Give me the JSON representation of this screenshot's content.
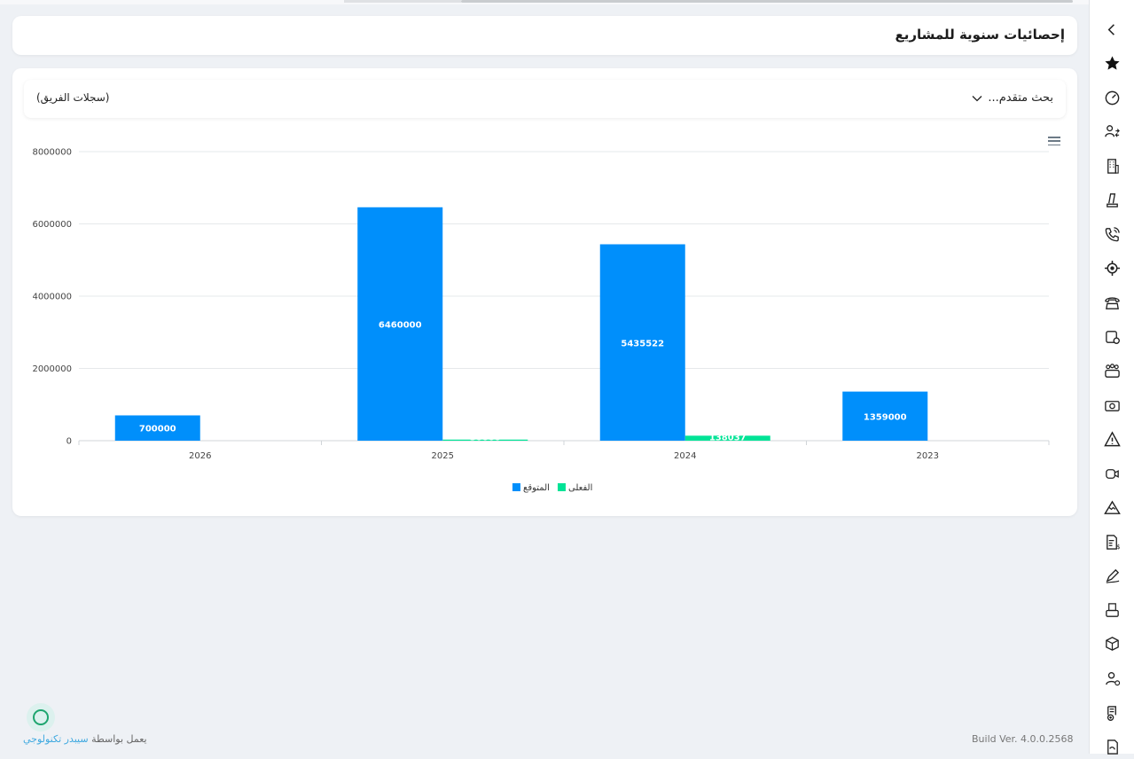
{
  "page": {
    "title": "إحصائيات سنوية للمشاريع",
    "advanced_search": "بحث متقدم...",
    "team_records": "(سجلات الفريق)",
    "footer_powered": "يعمل بواسطة",
    "footer_brand": "سيبدر تكنولوجي",
    "footer_build": "Build Ver. 4.0.0.2568"
  },
  "rail_icons": [
    "chevron-left-icon",
    "star-icon",
    "dashboard-icon",
    "users-swap-icon",
    "building-icon",
    "tool-icon",
    "phone-call-icon",
    "target-icon",
    "telephone-icon",
    "calendar-settings-icon",
    "group-icon",
    "money-icon",
    "warning-icon",
    "video-icon",
    "mountain-icon",
    "invoice-icon",
    "pen-icon",
    "printer-doc-icon",
    "box-icon",
    "user-money-icon",
    "doc-add-icon",
    "doc-hand-icon"
  ],
  "colors": {
    "expected": "#008ffb",
    "actual": "#00e396",
    "accent_brand": "#3fa9e0"
  },
  "chart_data": {
    "type": "bar",
    "categories": [
      "2026",
      "2025",
      "2024",
      "2023"
    ],
    "series": [
      {
        "name": "المتوقع",
        "values": [
          700000,
          6460000,
          5435522,
          1359000
        ]
      },
      {
        "name": "الفعلى",
        "values": [
          0,
          30000,
          138037,
          0
        ]
      }
    ],
    "data_labels": [
      [
        "700000",
        "6460000",
        "5435522",
        "1359000"
      ],
      [
        "",
        "30000",
        "138037",
        ""
      ]
    ],
    "ylim": [
      0,
      8000000
    ],
    "yticks": [
      "0",
      "2000000",
      "4000000",
      "6000000",
      "8000000"
    ],
    "title": "",
    "xlabel": "",
    "ylabel": "",
    "grid": true,
    "legend_position": "bottom"
  }
}
